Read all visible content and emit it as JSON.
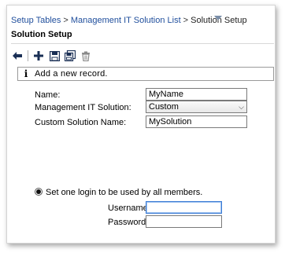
{
  "breadcrumb": {
    "items": [
      "Setup Tables",
      "Management IT Solution List"
    ],
    "separator": ">",
    "current": "Solution Setup"
  },
  "page": {
    "title": "Solution Setup"
  },
  "toolbar": {
    "buttons": [
      "back-arrow-icon",
      "add-plus-icon",
      "save-icon",
      "save-copy-icon",
      "delete-trash-icon"
    ]
  },
  "info": {
    "message": "Add a new record."
  },
  "form": {
    "name_label": "Name:",
    "name_value": "MyName",
    "solution_label": "Management IT Solution:",
    "solution_value": "Custom",
    "custom_name_label": "Custom Solution Name:",
    "custom_name_value": "MySolution"
  },
  "login": {
    "option_label": "Set one login to be used by all members.",
    "username_label": "Username:",
    "username_value": "",
    "password_label": "Password:",
    "password_value": ""
  },
  "colors": {
    "link": "#1f4e9c",
    "accent": "#1a4d8f"
  }
}
